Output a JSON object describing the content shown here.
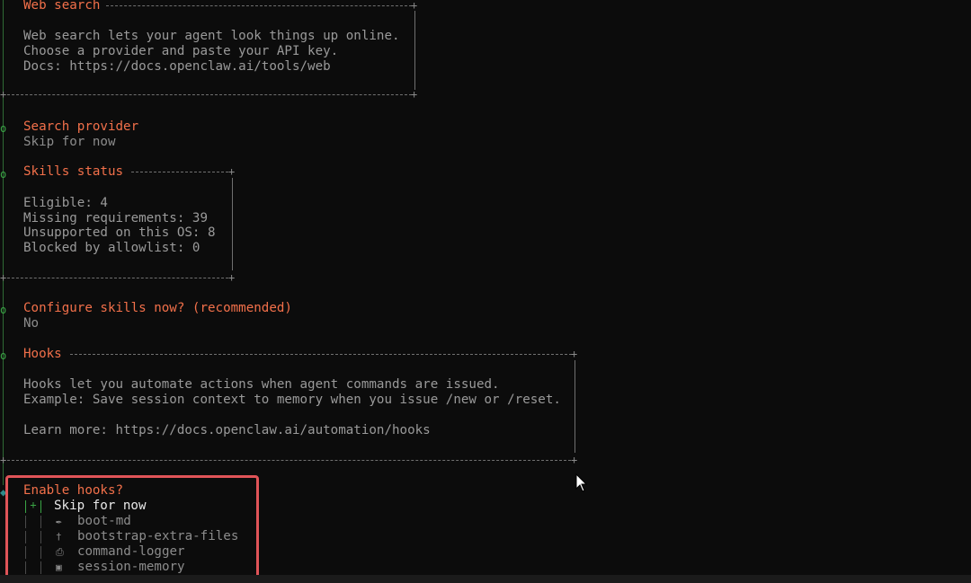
{
  "sections": {
    "web_search": {
      "title": "Web search",
      "lines": [
        "Web search lets your agent look things up online.",
        "Choose a provider and paste your API key.",
        "Docs: https://docs.openclaw.ai/tools/web"
      ]
    },
    "search_provider": {
      "title": "Search provider",
      "value": "Skip for now"
    },
    "skills_status": {
      "title": "Skills status",
      "lines": [
        "Eligible: 4",
        "Missing requirements: 39",
        "Unsupported on this OS: 8",
        "Blocked by allowlist: 0"
      ]
    },
    "configure_skills": {
      "title": "Configure skills now? (recommended)",
      "value": "No"
    },
    "hooks": {
      "title": "Hooks",
      "lines": [
        "Hooks let you automate actions when agent commands are issued.",
        "Example: Save session context to memory when you issue /new or /reset.",
        "Learn more: https://docs.openclaw.ai/automation/hooks"
      ]
    },
    "enable_hooks": {
      "title": "Enable hooks?",
      "options": [
        {
          "label": "Skip for now",
          "checked": true,
          "icon": ""
        },
        {
          "label": "boot-md",
          "checked": false,
          "icon": "rocket-icon"
        },
        {
          "label": "bootstrap-extra-files",
          "checked": false,
          "icon": "paperclip-icon"
        },
        {
          "label": "command-logger",
          "checked": false,
          "icon": "document-icon"
        },
        {
          "label": "session-memory",
          "checked": false,
          "icon": "floppy-icon"
        }
      ],
      "checkbox_on_mark": "+"
    }
  },
  "colors": {
    "background": "#0c0c0c",
    "heading": "#f2704a",
    "text": "#9a9a9a",
    "accent_green": "#3aa545",
    "highlight_border": "#e05458"
  }
}
